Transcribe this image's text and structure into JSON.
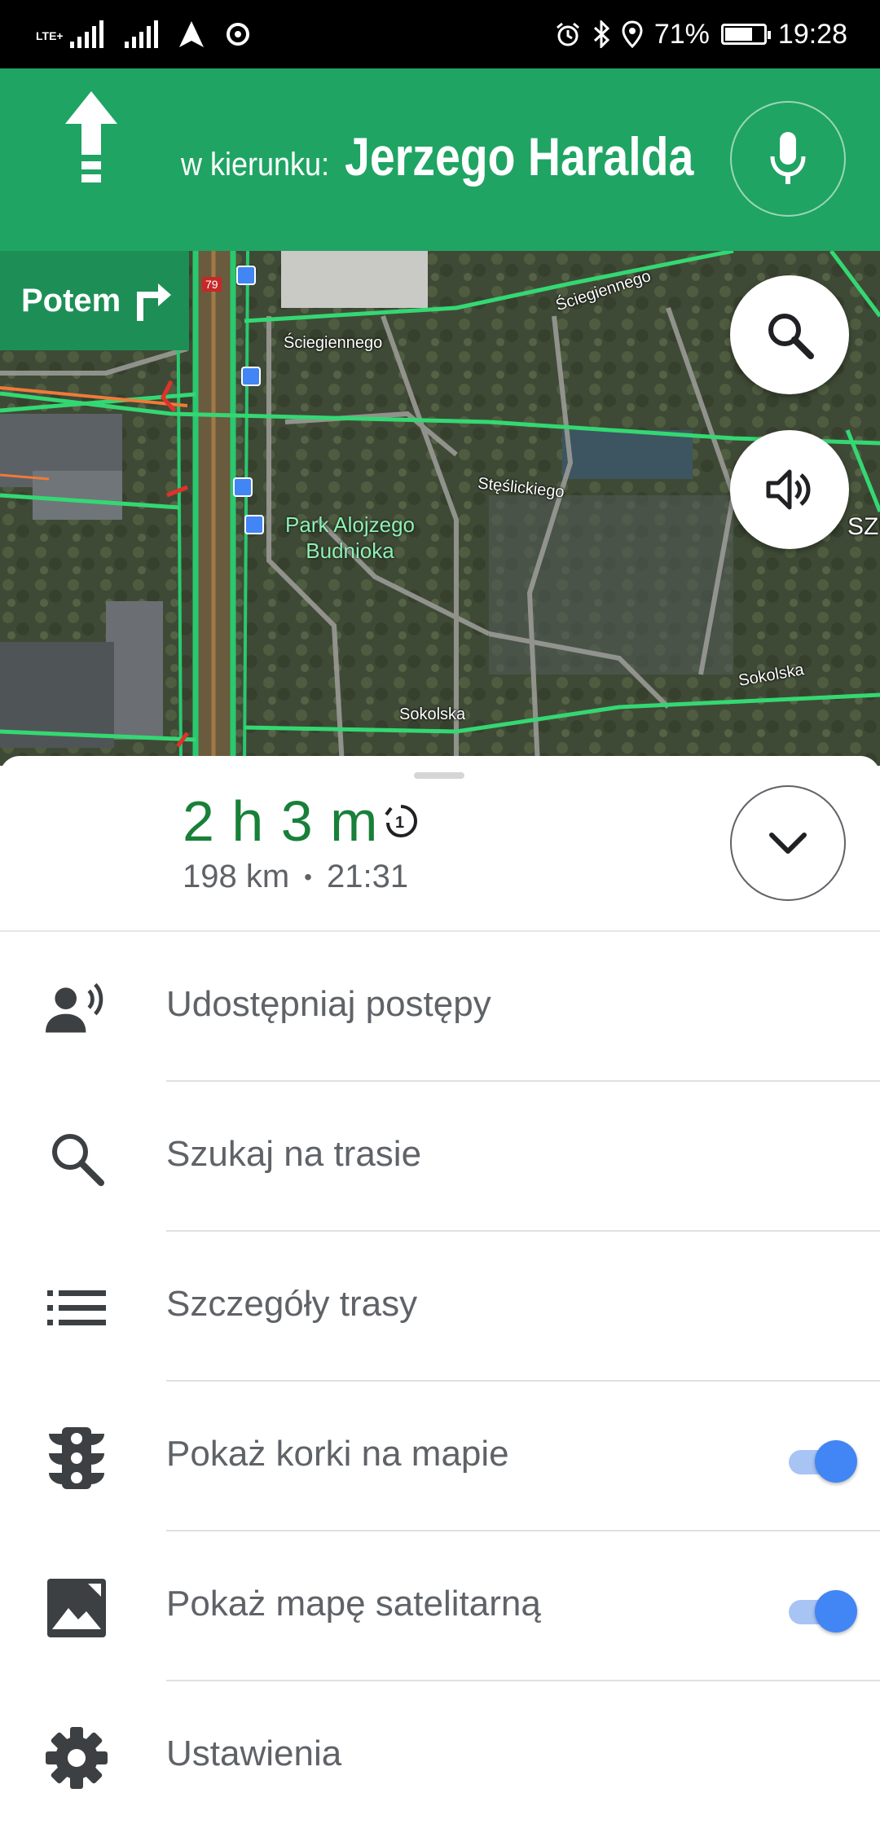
{
  "status_bar": {
    "network": "LTE+",
    "battery": "71%",
    "battery_level": 0.71,
    "time": "19:28"
  },
  "navigation": {
    "direction_prefix": "w kierunku:",
    "street": "Jerzego Haralda",
    "next_step_label": "Potem",
    "colors": {
      "header": "#1fa463",
      "chip": "#1d8f56"
    }
  },
  "map": {
    "street_labels": [
      "Ściegiennego",
      "Ściegiennego",
      "Stęślickiego",
      "Sokolska",
      "Sokolska",
      "SZU"
    ],
    "park_label_line1": "Park Alojzego",
    "park_label_line2": "Budnioka",
    "road_badge": "79"
  },
  "trip": {
    "duration": "2 h 3 m",
    "distance": "198 km",
    "separator": "•",
    "arrival": "21:31",
    "eta_color": "#188038"
  },
  "menu": [
    {
      "label": "Udostępniaj postępy",
      "icon": "share-progress-icon",
      "toggle": null
    },
    {
      "label": "Szukaj na trasie",
      "icon": "search-icon",
      "toggle": null
    },
    {
      "label": "Szczegóły trasy",
      "icon": "list-icon",
      "toggle": null
    },
    {
      "label": "Pokaż korki na mapie",
      "icon": "traffic-light-icon",
      "toggle": true
    },
    {
      "label": "Pokaż mapę satelitarną",
      "icon": "satellite-image-icon",
      "toggle": true
    },
    {
      "label": "Ustawienia",
      "icon": "gear-icon",
      "toggle": null
    }
  ]
}
